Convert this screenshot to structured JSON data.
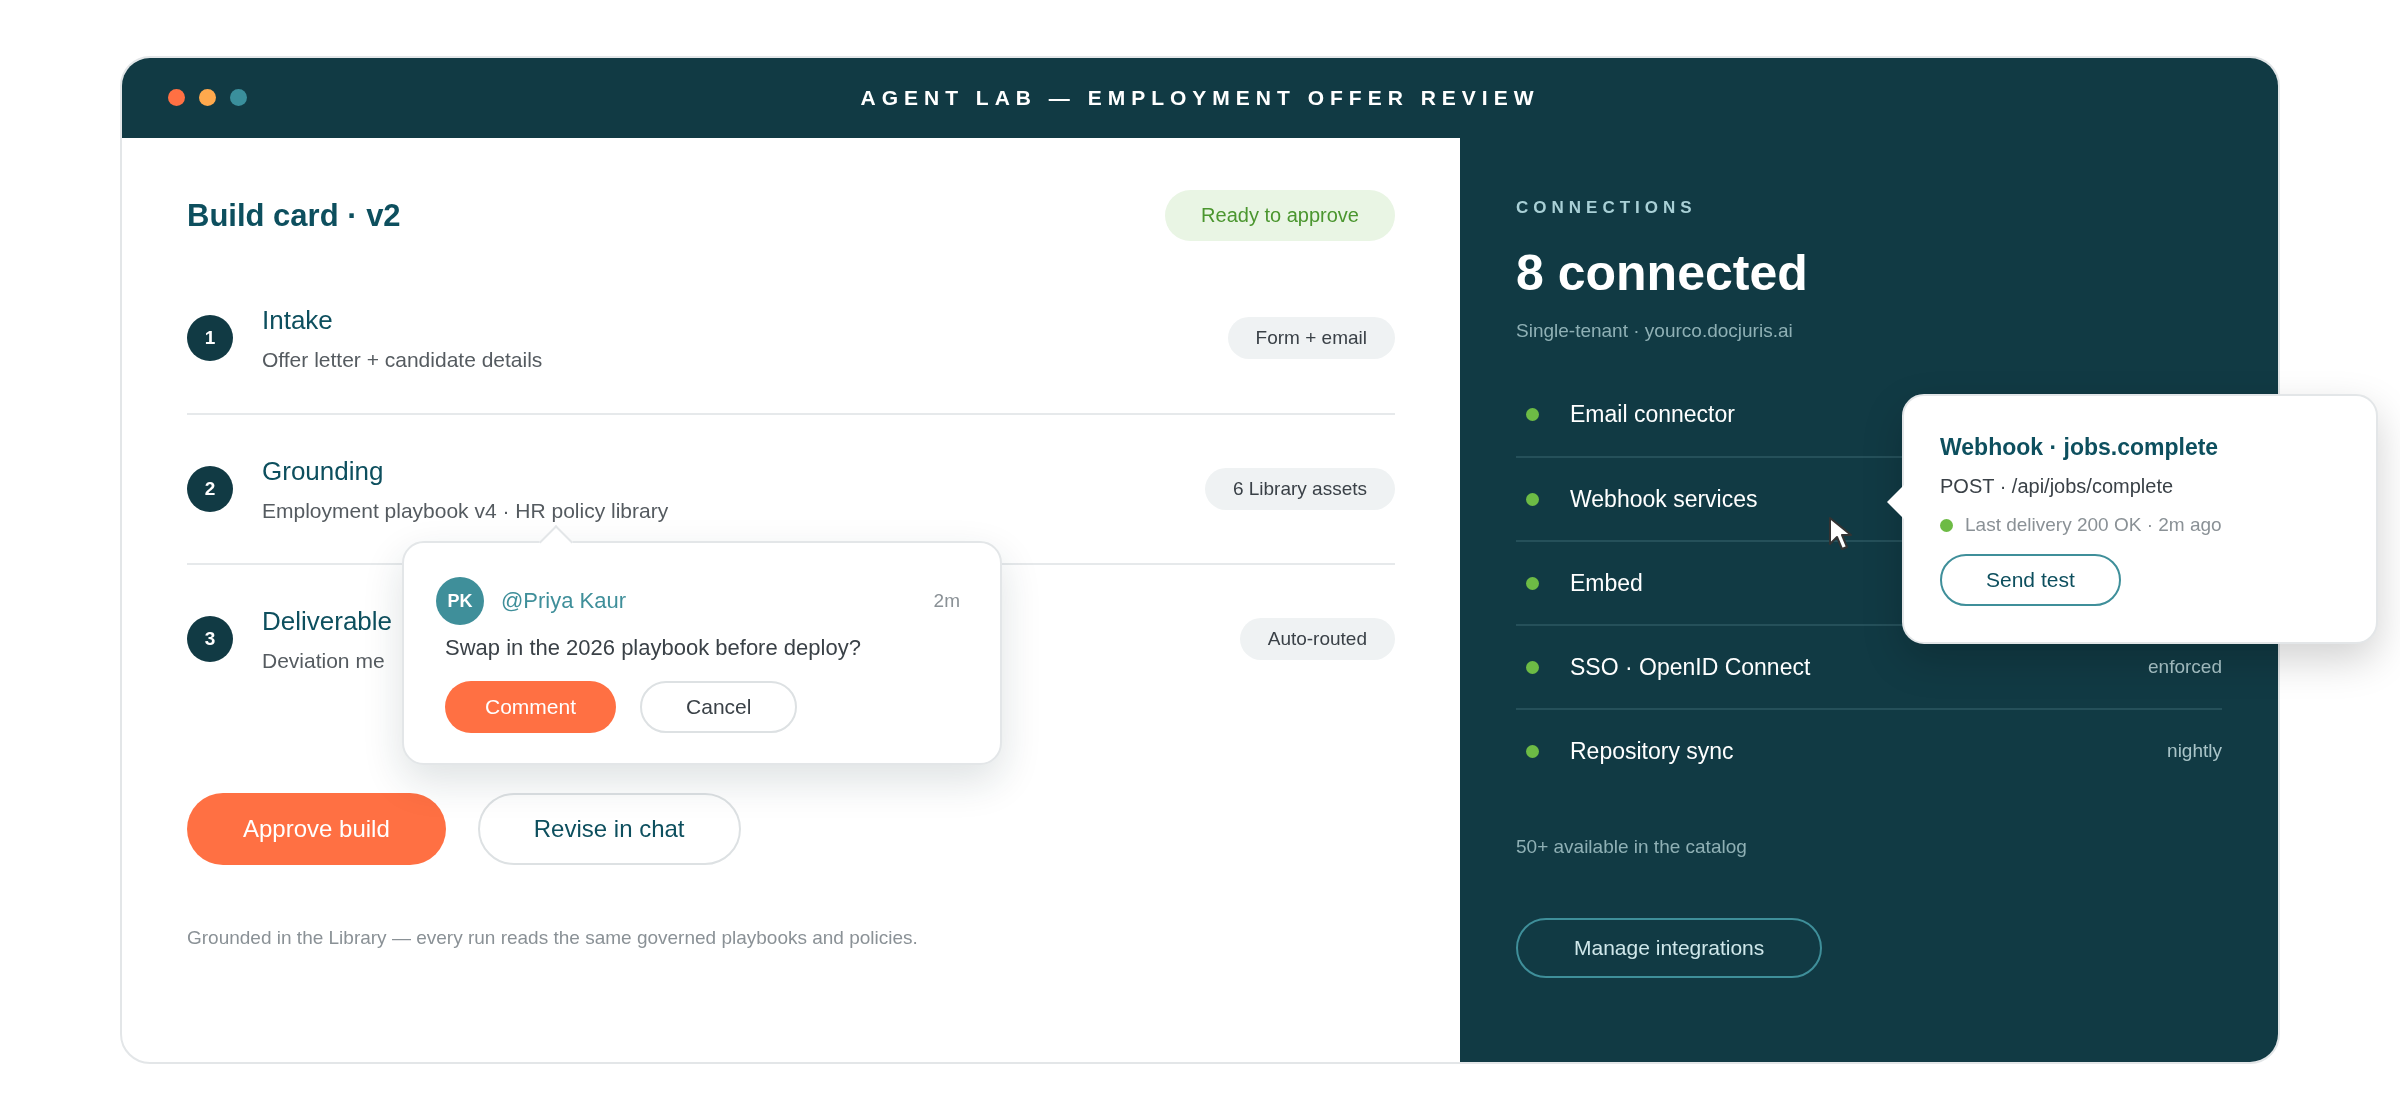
{
  "window": {
    "title": "AGENT LAB — EMPLOYMENT OFFER REVIEW"
  },
  "build": {
    "title": "Build card · v2",
    "status": "Ready to approve",
    "steps": [
      {
        "number": "1",
        "title": "Intake",
        "description": "Offer letter + candidate details",
        "chip": "Form + email"
      },
      {
        "number": "2",
        "title": "Grounding",
        "description": "Employment playbook v4 · HR policy library",
        "chip": "6 Library assets"
      },
      {
        "number": "3",
        "title": "Deliverable",
        "description": "Deviation me",
        "chip": "Auto-routed"
      }
    ],
    "comment": {
      "initials": "PK",
      "author": "@Priya Kaur",
      "time": "2m",
      "text": "Swap in the 2026 playbook before deploy?",
      "buttons": [
        {
          "label": "Comment",
          "kind": "primary"
        },
        {
          "label": "Cancel",
          "kind": "secondary"
        }
      ]
    },
    "actions": [
      {
        "label": "Approve build",
        "kind": "primary"
      },
      {
        "label": "Revise in chat",
        "kind": "secondary"
      }
    ],
    "footnote": "Grounded in the Library — every run reads the same governed playbooks and policies."
  },
  "connections": {
    "label": "CONNECTIONS",
    "heading": "8 connected",
    "subtitle": "Single-tenant · yourco.docjuris.ai",
    "items": [
      {
        "name": "Email connector"
      },
      {
        "name": "Webhook services",
        "hovered": true
      },
      {
        "name": "Embed"
      },
      {
        "name": "SSO · OpenID Connect",
        "value": "enforced"
      },
      {
        "name": "Repository sync",
        "value": "nightly"
      }
    ],
    "catalog": "50+ available in the catalog",
    "button": "Manage integrations",
    "popover": {
      "title": "Webhook · jobs.complete",
      "request": "POST · /api/jobs/complete",
      "delivery": "Last delivery 200 OK · 2m ago",
      "button": "Send test"
    }
  }
}
